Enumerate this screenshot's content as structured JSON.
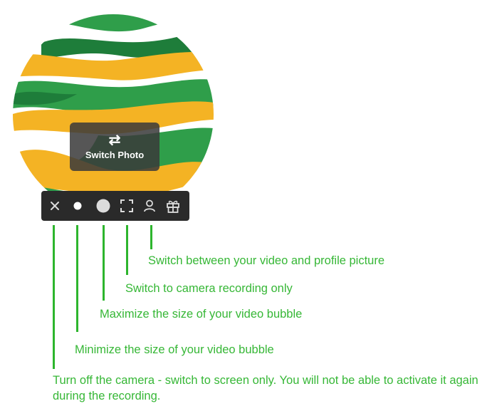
{
  "bubble": {
    "switch_label": "Switch Photo",
    "colors": {
      "green_dark": "#1e7d3a",
      "green": "#2f9e4a",
      "yellow": "#f4b324"
    }
  },
  "toolbar": {
    "buttons": [
      {
        "icon": "close-icon"
      },
      {
        "icon": "dot-small-icon"
      },
      {
        "icon": "dot-large-icon"
      },
      {
        "icon": "fullscreen-corners-icon"
      },
      {
        "icon": "person-icon"
      },
      {
        "icon": "gift-icon"
      }
    ]
  },
  "annotations": {
    "profile": "Switch between your video and profile picture",
    "camera_only": "Switch to camera recording only",
    "maximize": "Maximize the size of your video bubble",
    "minimize": "Minimize the size of your video bubble",
    "turn_off": "Turn off the camera - switch to screen only. You will not be able to activate it again during the recording."
  },
  "colors": {
    "annotation_text": "#36b736",
    "annotation_line": "#2db52d",
    "toolbar_bg": "#2a2a2a"
  }
}
